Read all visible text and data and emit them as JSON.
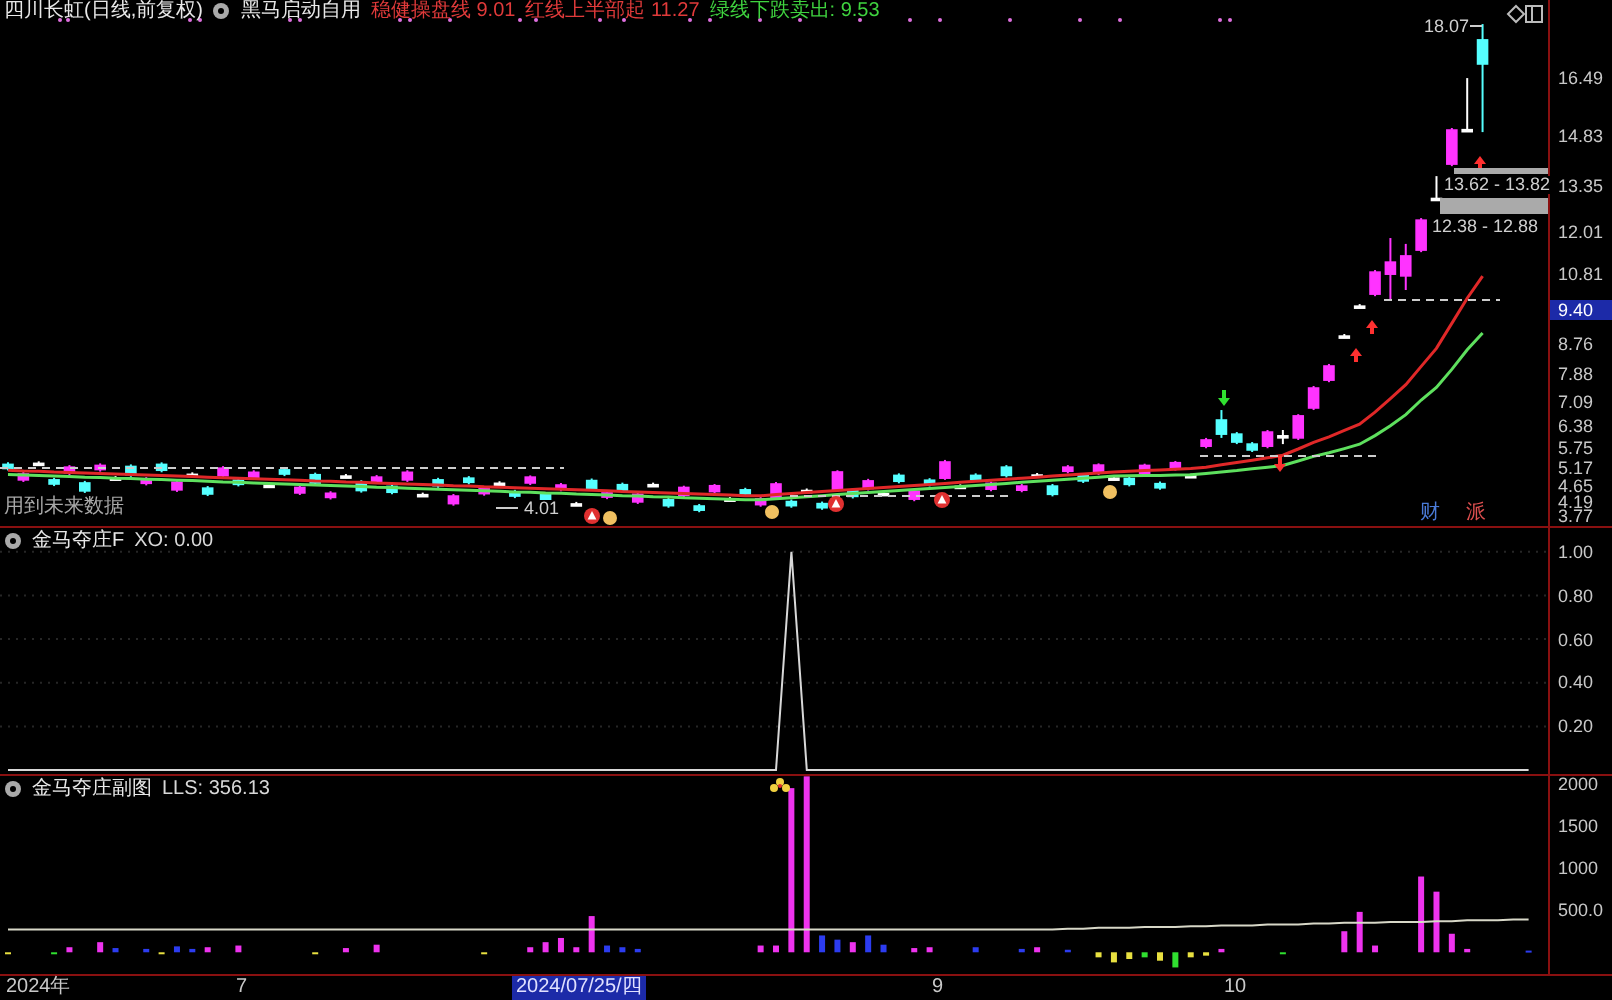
{
  "header": {
    "stock": "四川长虹(日线,前复权)",
    "indicator": "黑马启动自用",
    "values": [
      {
        "text": "稳健操盘线 9.01",
        "color": "#e03a3a"
      },
      {
        "text": "红线上半部起 11.27",
        "color": "#e03a3a"
      },
      {
        "text": "绿线下跌卖出: 9.53",
        "color": "#3fd23f"
      }
    ]
  },
  "price_panel": {
    "chart_data": {
      "type": "candlestick",
      "ylim": [
        3.77,
        18.77
      ],
      "yticks": [
        {
          "value": 16.49,
          "label": "16.49"
        },
        {
          "value": 14.83,
          "label": "14.83"
        },
        {
          "value": 13.35,
          "label": "13.35"
        },
        {
          "value": 12.01,
          "label": "12.01"
        },
        {
          "value": 10.81,
          "label": "10.81"
        },
        {
          "value": 8.76,
          "label": "8.76"
        },
        {
          "value": 7.88,
          "label": "7.88"
        },
        {
          "value": 7.09,
          "label": "7.09"
        },
        {
          "value": 6.38,
          "label": "6.38"
        },
        {
          "value": 5.75,
          "label": "5.75"
        },
        {
          "value": 5.17,
          "label": "5.17"
        },
        {
          "value": 4.65,
          "label": "4.65"
        },
        {
          "value": 4.19,
          "label": "4.19"
        },
        {
          "value": 3.77,
          "label": "3.77"
        }
      ],
      "ohlc": [
        [
          5.27,
          5.33,
          5.09,
          5.15
        ],
        [
          4.82,
          5.05,
          4.76,
          4.99
        ],
        [
          5.3,
          5.36,
          5.24,
          5.3
        ],
        [
          4.82,
          4.88,
          4.64,
          4.7
        ],
        [
          5.02,
          5.25,
          4.96,
          5.19
        ],
        [
          4.73,
          4.79,
          4.44,
          4.5
        ],
        [
          5.12,
          5.3,
          5.06,
          5.24
        ],
        [
          4.87,
          4.93,
          4.81,
          4.87
        ],
        [
          5.21,
          5.27,
          4.91,
          4.97
        ],
        [
          4.72,
          4.9,
          4.66,
          4.84
        ],
        [
          5.27,
          5.33,
          5.04,
          5.1
        ],
        [
          4.53,
          4.81,
          4.47,
          4.75
        ],
        [
          4.98,
          5.04,
          4.92,
          4.98
        ],
        [
          4.58,
          4.64,
          4.35,
          4.41
        ],
        [
          4.94,
          5.22,
          4.88,
          5.16
        ],
        [
          4.81,
          4.87,
          4.63,
          4.69
        ],
        [
          4.88,
          5.1,
          4.82,
          5.04
        ],
        [
          4.66,
          4.72,
          4.6,
          4.66
        ],
        [
          5.11,
          5.17,
          4.93,
          4.99
        ],
        [
          4.44,
          4.66,
          4.38,
          4.6
        ],
        [
          4.97,
          5.03,
          4.67,
          4.73
        ],
        [
          4.31,
          4.49,
          4.25,
          4.43
        ],
        [
          4.93,
          4.99,
          4.87,
          4.93
        ],
        [
          4.75,
          4.81,
          4.45,
          4.51
        ],
        [
          4.78,
          4.96,
          4.72,
          4.9
        ],
        [
          4.63,
          4.69,
          4.4,
          4.46
        ],
        [
          4.82,
          5.1,
          4.76,
          5.04
        ],
        [
          4.39,
          4.45,
          4.33,
          4.39
        ],
        [
          4.82,
          4.88,
          4.59,
          4.65
        ],
        [
          4.13,
          4.41,
          4.07,
          4.35
        ],
        [
          4.87,
          4.93,
          4.69,
          4.75
        ],
        [
          4.42,
          4.64,
          4.36,
          4.59
        ],
        [
          4.72,
          4.78,
          4.66,
          4.72
        ],
        [
          4.47,
          4.53,
          4.29,
          4.35
        ],
        [
          4.73,
          4.95,
          4.67,
          4.9
        ],
        [
          4.39,
          4.45,
          4.09,
          4.15
        ],
        [
          4.55,
          4.73,
          4.49,
          4.67
        ],
        [
          4.12,
          4.18,
          4.06,
          4.12
        ],
        [
          4.8,
          4.86,
          4.5,
          4.56
        ],
        [
          4.32,
          4.5,
          4.26,
          4.44
        ],
        [
          4.68,
          4.74,
          4.45,
          4.51
        ],
        [
          4.18,
          4.46,
          4.12,
          4.4
        ],
        [
          4.68,
          4.74,
          4.62,
          4.68
        ],
        [
          4.24,
          4.3,
          4.01,
          4.07
        ],
        [
          4.37,
          4.65,
          4.31,
          4.6
        ],
        [
          4.06,
          4.12,
          3.88,
          3.94
        ],
        [
          4.48,
          4.7,
          4.42,
          4.65
        ],
        [
          4.26,
          4.32,
          4.2,
          4.26
        ],
        [
          4.53,
          4.59,
          4.35,
          4.41
        ],
        [
          4.1,
          4.32,
          4.04,
          4.27
        ],
        [
          4.29,
          4.76,
          4.25,
          4.7
        ],
        [
          4.19,
          4.25,
          4.01,
          4.07
        ],
        [
          4.51,
          4.57,
          4.45,
          4.51
        ],
        [
          4.13,
          4.19,
          3.95,
          4.01
        ],
        [
          4.52,
          5.1,
          4.47,
          5.05
        ],
        [
          4.51,
          4.57,
          4.28,
          4.34
        ],
        [
          4.57,
          4.85,
          4.51,
          4.79
        ],
        [
          4.42,
          4.48,
          4.36,
          4.42
        ],
        [
          4.95,
          5.01,
          4.72,
          4.78
        ],
        [
          4.26,
          4.54,
          4.2,
          4.49
        ],
        [
          4.81,
          4.87,
          4.63,
          4.69
        ],
        [
          4.87,
          5.4,
          4.82,
          5.34
        ],
        [
          4.63,
          4.69,
          4.57,
          4.63
        ],
        [
          4.95,
          5.01,
          4.77,
          4.83
        ],
        [
          4.55,
          4.77,
          4.49,
          4.72
        ],
        [
          5.19,
          5.25,
          4.89,
          4.95
        ],
        [
          4.52,
          4.7,
          4.46,
          4.64
        ],
        [
          4.96,
          5.02,
          4.9,
          4.96
        ],
        [
          4.64,
          4.7,
          4.34,
          4.4
        ],
        [
          5.07,
          5.25,
          5.01,
          5.19
        ],
        [
          4.96,
          5.02,
          4.73,
          4.79
        ],
        [
          5.02,
          5.3,
          4.96,
          5.25
        ],
        [
          4.87,
          4.93,
          4.81,
          4.87
        ],
        [
          4.86,
          4.92,
          4.63,
          4.69
        ],
        [
          5.01,
          5.29,
          4.95,
          5.24
        ],
        [
          4.71,
          4.77,
          4.53,
          4.59
        ],
        [
          5.15,
          5.37,
          5.09,
          5.32
        ],
        [
          4.94,
          5.0,
          4.88,
          4.94
        ],
        [
          5.8,
          6.04,
          5.74,
          5.98
        ],
        [
          6.56,
          6.85,
          6.04,
          6.15
        ],
        [
          6.15,
          6.21,
          5.86,
          5.92
        ],
        [
          5.86,
          5.92,
          5.63,
          5.69
        ],
        [
          5.8,
          6.27,
          5.74,
          6.21
        ],
        [
          6.1,
          6.27,
          5.86,
          6.1
        ],
        [
          6.04,
          6.73,
          5.98,
          6.68
        ],
        [
          6.91,
          7.55,
          6.85,
          7.49
        ],
        [
          7.72,
          8.19,
          7.66,
          8.13
        ],
        [
          9.0,
          9.06,
          8.94,
          9.0
        ],
        [
          9.87,
          9.93,
          9.81,
          9.87
        ],
        [
          10.22,
          10.92,
          10.16,
          10.86
        ],
        [
          10.8,
          11.85,
          10.05,
          11.15
        ],
        [
          10.75,
          11.68,
          10.34,
          11.33
        ],
        [
          11.5,
          12.43,
          11.44,
          12.37
        ],
        [
          13.0,
          13.65,
          12.96,
          13.0
        ],
        [
          14.0,
          15.05,
          13.94,
          14.99
        ],
        [
          15.0,
          16.5,
          14.99,
          15.0
        ],
        [
          17.61,
          18.07,
          14.93,
          16.91
        ]
      ],
      "series": [
        {
          "type": "line",
          "color": "#e02828",
          "values": [
            5.1,
            5.08,
            5.07,
            5.05,
            5.04,
            5.02,
            5.01,
            4.99,
            4.98,
            4.96,
            4.95,
            4.93,
            4.92,
            4.9,
            4.88,
            4.87,
            4.85,
            4.84,
            4.82,
            4.81,
            4.79,
            4.78,
            4.76,
            4.75,
            4.73,
            4.72,
            4.7,
            4.68,
            4.67,
            4.65,
            4.64,
            4.62,
            4.61,
            4.59,
            4.58,
            4.56,
            4.55,
            4.53,
            4.52,
            4.5,
            4.48,
            4.47,
            4.45,
            4.44,
            4.42,
            4.41,
            4.39,
            4.38,
            4.36,
            4.36,
            4.39,
            4.42,
            4.45,
            4.48,
            4.51,
            4.54,
            4.57,
            4.6,
            4.63,
            4.66,
            4.69,
            4.72,
            4.75,
            4.78,
            4.81,
            4.84,
            4.87,
            4.9,
            4.93,
            4.96,
            4.99,
            5.02,
            5.05,
            5.07,
            5.09,
            5.11,
            5.13,
            5.15,
            5.19,
            5.26,
            5.32,
            5.39,
            5.46,
            5.54,
            5.72,
            5.91,
            6.07,
            6.26,
            6.44,
            6.79,
            7.18,
            7.59,
            8.12,
            8.64,
            9.37,
            10.1,
            10.74
          ]
        },
        {
          "type": "line",
          "color": "#5ee05e",
          "values": [
            4.98,
            4.96,
            4.95,
            4.93,
            4.92,
            4.9,
            4.89,
            4.87,
            4.86,
            4.84,
            4.83,
            4.81,
            4.8,
            4.78,
            4.76,
            4.75,
            4.73,
            4.72,
            4.7,
            4.69,
            4.67,
            4.66,
            4.64,
            4.63,
            4.61,
            4.6,
            4.58,
            4.56,
            4.55,
            4.53,
            4.52,
            4.5,
            4.49,
            4.47,
            4.46,
            4.44,
            4.43,
            4.41,
            4.4,
            4.38,
            4.36,
            4.35,
            4.33,
            4.32,
            4.3,
            4.29,
            4.27,
            4.26,
            4.24,
            4.24,
            4.27,
            4.3,
            4.33,
            4.36,
            4.39,
            4.42,
            4.45,
            4.48,
            4.51,
            4.54,
            4.57,
            4.6,
            4.63,
            4.66,
            4.69,
            4.72,
            4.75,
            4.78,
            4.81,
            4.84,
            4.87,
            4.9,
            4.93,
            4.94,
            4.95,
            4.95,
            4.96,
            4.97,
            5.01,
            5.05,
            5.09,
            5.14,
            5.19,
            5.24,
            5.37,
            5.5,
            5.61,
            5.73,
            5.86,
            6.11,
            6.39,
            6.72,
            7.14,
            7.51,
            8.03,
            8.6,
            9.09
          ]
        }
      ]
    },
    "current_price": "9.40",
    "annotations": {
      "high": "18.07",
      "zone_upper": "13.62 - 13.82",
      "zone_lower": "12.38 - 12.88",
      "low": "4.01",
      "note": "用到未来数据"
    },
    "event_marks": [
      {
        "text": "财",
        "color": "#4a7bd8"
      },
      {
        "text": "派",
        "color": "#e05050"
      }
    ]
  },
  "xo_panel": {
    "title": "金马夺庄F",
    "reading": "XO: 0.00",
    "chart_data": {
      "type": "line",
      "grid": true,
      "ylim": [
        -0.018,
        1.109
      ],
      "yticks": [
        {
          "value": 1,
          "label": "1.00"
        },
        {
          "value": 0.8,
          "label": "0.80"
        },
        {
          "value": 0.6,
          "label": "0.60"
        },
        {
          "value": 0.4,
          "label": "0.40"
        },
        {
          "value": 0.2,
          "label": "0.20"
        }
      ],
      "series": [
        {
          "color": "#d8d8d8",
          "values": [
            0,
            0,
            0,
            0,
            0,
            0,
            0,
            0,
            0,
            0,
            0,
            0,
            0,
            0,
            0,
            0,
            0,
            0,
            0,
            0,
            0,
            0,
            0,
            0,
            0,
            0,
            0,
            0,
            0,
            0,
            0,
            0,
            0,
            0,
            0,
            0,
            0,
            0,
            0,
            0,
            0,
            0,
            0,
            0,
            0,
            0,
            0,
            0,
            0,
            0,
            0,
            1,
            0,
            0,
            0,
            0,
            0,
            0,
            0,
            0,
            0,
            0,
            0,
            0,
            0,
            0,
            0,
            0,
            0,
            0,
            0,
            0,
            0,
            0,
            0,
            0,
            0,
            0,
            0,
            0,
            0,
            0,
            0,
            0,
            0,
            0,
            0,
            0,
            0,
            0,
            0,
            0,
            0,
            0,
            0,
            0,
            0,
            0,
            0,
            0
          ]
        }
      ]
    }
  },
  "lls_panel": {
    "title": "金马夺庄副图",
    "reading": "LLS: 356.13",
    "chart_data": {
      "type": "bar",
      "ylim": [
        -258,
        2094
      ],
      "yticks": [
        {
          "value": 2000,
          "label": "2000"
        },
        {
          "value": 1500,
          "label": "1500"
        },
        {
          "value": 1000,
          "label": "1000"
        },
        {
          "value": 500,
          "label": "500.0"
        }
      ],
      "series": [
        {
          "color": "#ee33ee",
          "values": [
            null,
            null,
            null,
            null,
            60,
            null,
            120,
            null,
            null,
            null,
            null,
            null,
            null,
            60,
            null,
            80,
            null,
            null,
            null,
            null,
            null,
            null,
            50,
            null,
            90,
            null,
            null,
            null,
            null,
            null,
            null,
            null,
            null,
            null,
            60,
            120,
            170,
            60,
            430,
            null,
            null,
            null,
            null,
            null,
            null,
            null,
            null,
            null,
            null,
            80,
            80,
            1950,
            2090,
            null,
            null,
            120,
            null,
            null,
            null,
            50,
            60,
            null,
            null,
            null,
            null,
            null,
            null,
            60,
            null,
            null,
            null,
            null,
            null,
            null,
            null,
            null,
            null,
            null,
            null,
            40,
            null,
            null,
            null,
            null,
            null,
            null,
            null,
            250,
            480,
            80,
            null,
            null,
            900,
            720,
            220,
            40,
            null,
            null,
            null,
            null
          ]
        },
        {
          "color": "#2c3cf0",
          "values": [
            null,
            null,
            null,
            null,
            null,
            null,
            null,
            50,
            null,
            40,
            null,
            70,
            40,
            null,
            null,
            null,
            null,
            null,
            null,
            null,
            null,
            null,
            null,
            null,
            null,
            null,
            null,
            null,
            null,
            null,
            null,
            null,
            null,
            null,
            null,
            null,
            null,
            null,
            null,
            80,
            60,
            40,
            null,
            null,
            null,
            null,
            null,
            null,
            null,
            null,
            null,
            null,
            null,
            200,
            150,
            null,
            200,
            90,
            null,
            null,
            null,
            null,
            null,
            60,
            null,
            null,
            40,
            null,
            null,
            30,
            null,
            null,
            null,
            null,
            null,
            null,
            null,
            null,
            null,
            null,
            null,
            null,
            null,
            null,
            null,
            null,
            null,
            null,
            null,
            null,
            null,
            null,
            null,
            null,
            null,
            null,
            null,
            null,
            null,
            20
          ]
        },
        {
          "color": "#e8e040",
          "values": [
            -20,
            null,
            null,
            null,
            null,
            null,
            null,
            null,
            null,
            null,
            -20,
            null,
            null,
            null,
            null,
            null,
            null,
            null,
            null,
            null,
            -20,
            null,
            null,
            null,
            null,
            null,
            null,
            null,
            null,
            null,
            null,
            -20,
            null,
            null,
            null,
            null,
            null,
            null,
            null,
            null,
            null,
            null,
            null,
            null,
            null,
            null,
            null,
            null,
            null,
            null,
            null,
            null,
            null,
            null,
            null,
            null,
            null,
            null,
            null,
            null,
            null,
            null,
            null,
            null,
            null,
            null,
            null,
            null,
            null,
            null,
            null,
            -60,
            -120,
            -80,
            null,
            -100,
            null,
            -60,
            -40,
            null,
            null,
            null,
            null,
            null,
            null,
            null,
            null,
            null,
            null,
            null,
            null,
            null,
            null,
            null,
            null,
            null,
            null,
            null,
            null,
            null
          ]
        },
        {
          "color": "#30e030",
          "values": [
            null,
            null,
            null,
            -20,
            null,
            null,
            null,
            null,
            null,
            null,
            null,
            null,
            null,
            null,
            null,
            null,
            null,
            null,
            null,
            null,
            null,
            null,
            null,
            null,
            null,
            null,
            null,
            null,
            null,
            null,
            null,
            null,
            null,
            null,
            null,
            null,
            null,
            null,
            null,
            null,
            null,
            null,
            null,
            null,
            null,
            null,
            null,
            null,
            null,
            null,
            null,
            null,
            null,
            null,
            null,
            null,
            null,
            null,
            null,
            null,
            null,
            null,
            null,
            null,
            null,
            null,
            null,
            null,
            null,
            null,
            null,
            null,
            null,
            null,
            -60,
            null,
            -180,
            null,
            null,
            null,
            null,
            null,
            null,
            -20,
            null,
            null,
            null,
            null,
            null,
            null,
            null,
            null,
            null,
            null,
            null,
            null,
            null,
            null,
            null,
            null
          ]
        },
        {
          "type": "line",
          "color": "#d8d8c8",
          "values": [
            270,
            270,
            270,
            270,
            270,
            270,
            270,
            270,
            270,
            270,
            270,
            270,
            270,
            270,
            270,
            270,
            270,
            270,
            270,
            270,
            270,
            270,
            270,
            270,
            270,
            270,
            270,
            270,
            270,
            270,
            270,
            270,
            270,
            270,
            270,
            270,
            270,
            270,
            270,
            270,
            270,
            270,
            270,
            270,
            270,
            270,
            270,
            270,
            270,
            270,
            270,
            270,
            270,
            270,
            270,
            270,
            270,
            270,
            270,
            270,
            270,
            270,
            270,
            270,
            270,
            270,
            270,
            270,
            270,
            280,
            280,
            290,
            290,
            290,
            300,
            300,
            300,
            310,
            310,
            320,
            320,
            320,
            330,
            330,
            330,
            340,
            340,
            350,
            350,
            350,
            360,
            360,
            360,
            370,
            370,
            380,
            380,
            380,
            390,
            390
          ]
        }
      ]
    }
  },
  "x_axis": [
    {
      "text": "2024年",
      "highlighted": false
    },
    {
      "text": "7",
      "highlighted": false
    },
    {
      "text": "2024/07/25/四",
      "highlighted": true
    },
    {
      "text": "9",
      "highlighted": false
    },
    {
      "text": "10",
      "highlighted": false
    }
  ]
}
